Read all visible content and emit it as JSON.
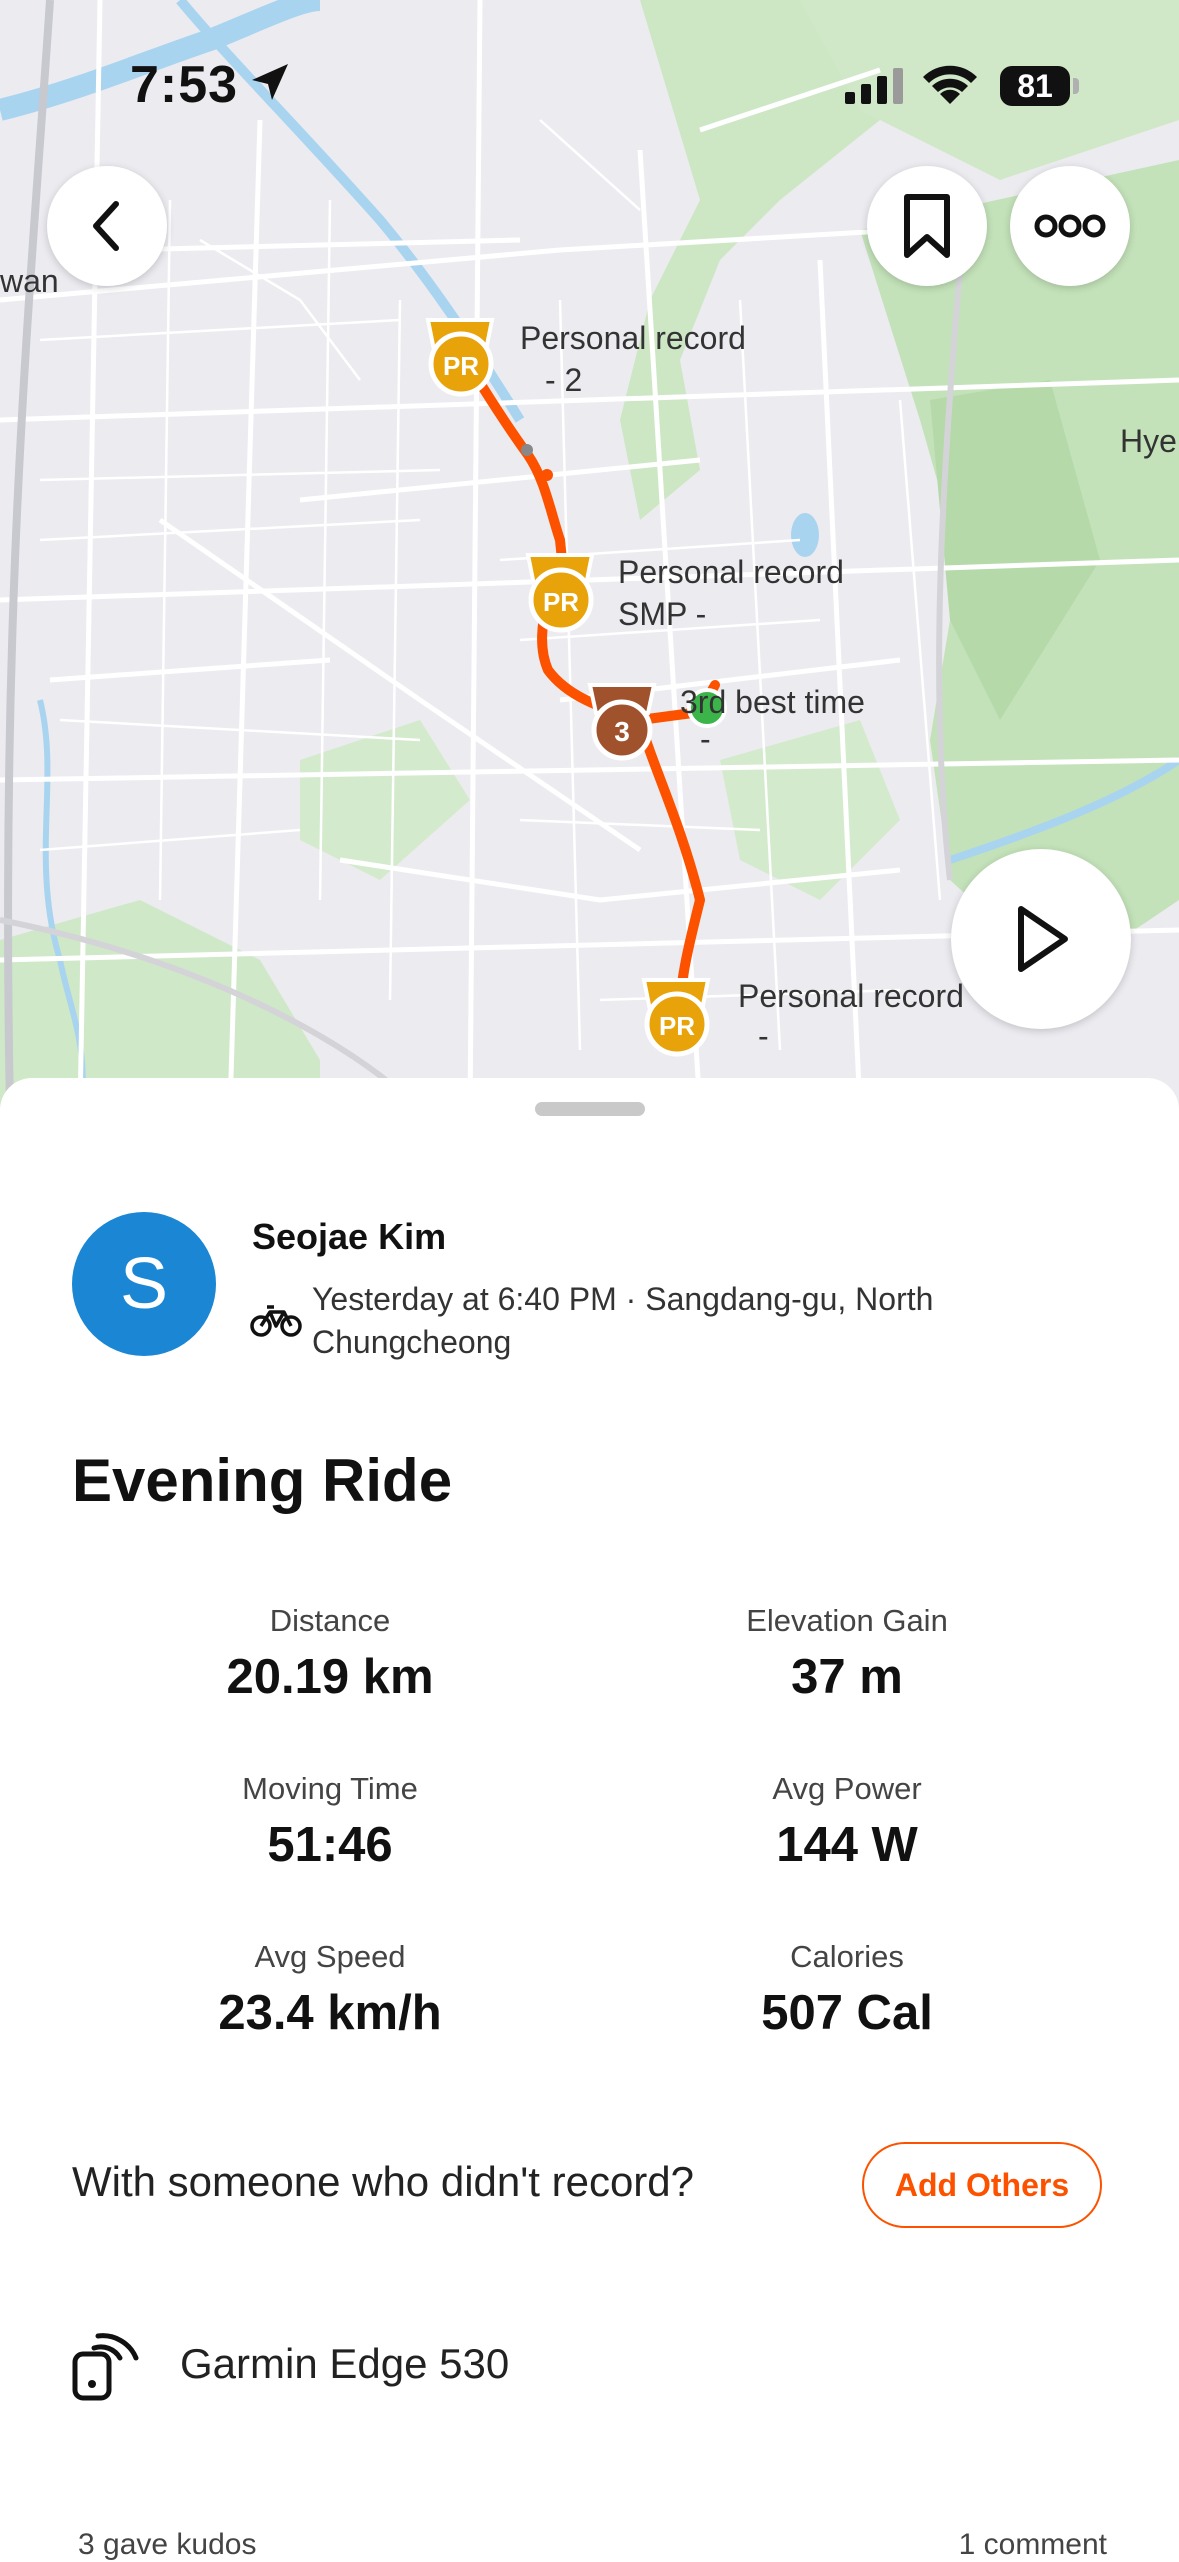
{
  "status_bar": {
    "time": "7:53",
    "battery": "81"
  },
  "map": {
    "labels": {
      "edge_left": "wan",
      "edge_right": "Hye",
      "pr1_title": "Personal record",
      "pr1_sub": "- 2",
      "pr2_title": "Personal record",
      "pr2_sub": "SMP -",
      "third_title": "3rd best time",
      "third_sub": "-",
      "pr3_title": "Personal record",
      "pr3_sub": "-"
    },
    "badges": {
      "pr": "PR",
      "third": "3"
    },
    "colors": {
      "route": "#fc5200",
      "pr_badge": "#e8a30a",
      "third_badge": "#a0522d",
      "start_marker": "#3bb54a"
    }
  },
  "buttons": {
    "back": "back",
    "bookmark": "bookmark",
    "more": "more",
    "play": "play"
  },
  "activity": {
    "athlete": {
      "initial": "S",
      "name": "Seojae Kim"
    },
    "meta": "Yesterday at 6:40 PM · Sangdang-gu, North Chungcheong",
    "title": "Evening Ride",
    "stats": [
      {
        "label": "Distance",
        "value": "20.19 km"
      },
      {
        "label": "Elevation Gain",
        "value": "37 m"
      },
      {
        "label": "Moving Time",
        "value": "51:46"
      },
      {
        "label": "Avg Power",
        "value": "144 W"
      },
      {
        "label": "Avg Speed",
        "value": "23.4 km/h"
      },
      {
        "label": "Calories",
        "value": "507 Cal"
      }
    ],
    "with_others_text": "With someone who didn't record?",
    "add_others_label": "Add Others",
    "device": "Garmin Edge 530",
    "kudos_text": "3 gave kudos",
    "comments_text": "1 comment"
  }
}
